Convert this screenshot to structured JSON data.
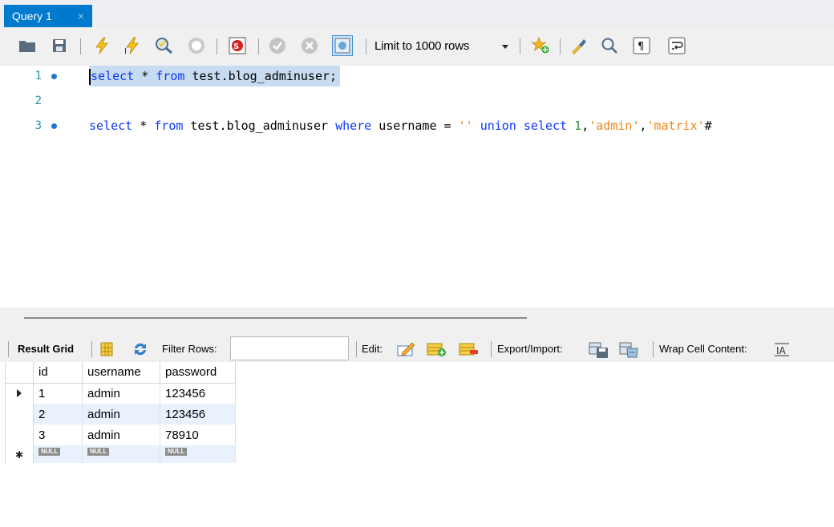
{
  "tab": {
    "label": "Query 1",
    "close": "×"
  },
  "toolbar": {
    "limit_label": "Limit to 1000 rows",
    "icons": [
      "open-file-icon",
      "save-icon",
      "execute-icon",
      "execute-current-icon",
      "explain-icon",
      "stop-icon",
      "toggle-error-icon",
      "commit-icon",
      "rollback-icon",
      "autocommit-icon",
      "add-snippet-icon",
      "beautify-icon",
      "find-icon",
      "invisible-chars-icon",
      "wrap-lines-icon"
    ]
  },
  "editor": {
    "lines": [
      {
        "num": "1",
        "dot": true
      },
      {
        "num": "2",
        "dot": false
      },
      {
        "num": "3",
        "dot": true
      }
    ],
    "line1": {
      "kw1": "select",
      "t1": " * ",
      "kw2": "from",
      "t2": " test.blog_adminuser;"
    },
    "line3": {
      "kw1": "select",
      "t1": " * ",
      "kw2": "from",
      "t2": " test.blog_adminuser ",
      "kw3": "where",
      "t3": " username = ",
      "s1": "''",
      "t4": " ",
      "kw4": "union",
      "t5": " ",
      "kw5": "select",
      "t6": " ",
      "n1": "1",
      "t7": ",",
      "s2": "'admin'",
      "t8": ",",
      "s3": "'matrix'",
      "t9": "#"
    }
  },
  "result_toolbar": {
    "result_grid_label": "Result Grid",
    "filter_label": "Filter Rows:",
    "filter_value": "",
    "edit_label": "Edit:",
    "export_label": "Export/Import:",
    "wrap_label": "Wrap Cell Content:"
  },
  "grid": {
    "columns": [
      "id",
      "username",
      "password"
    ],
    "rows": [
      [
        "1",
        "admin",
        "123456"
      ],
      [
        "2",
        "admin",
        "123456"
      ],
      [
        "3",
        "admin",
        "78910"
      ]
    ],
    "null_label": "NULL"
  },
  "colors": {
    "tab": "#007acc",
    "keyword": "#0b37ff",
    "string": "#f0841a",
    "number": "#2e8b3b",
    "selection": "#c7dcf1",
    "row_alt": "#e8f1fc"
  }
}
